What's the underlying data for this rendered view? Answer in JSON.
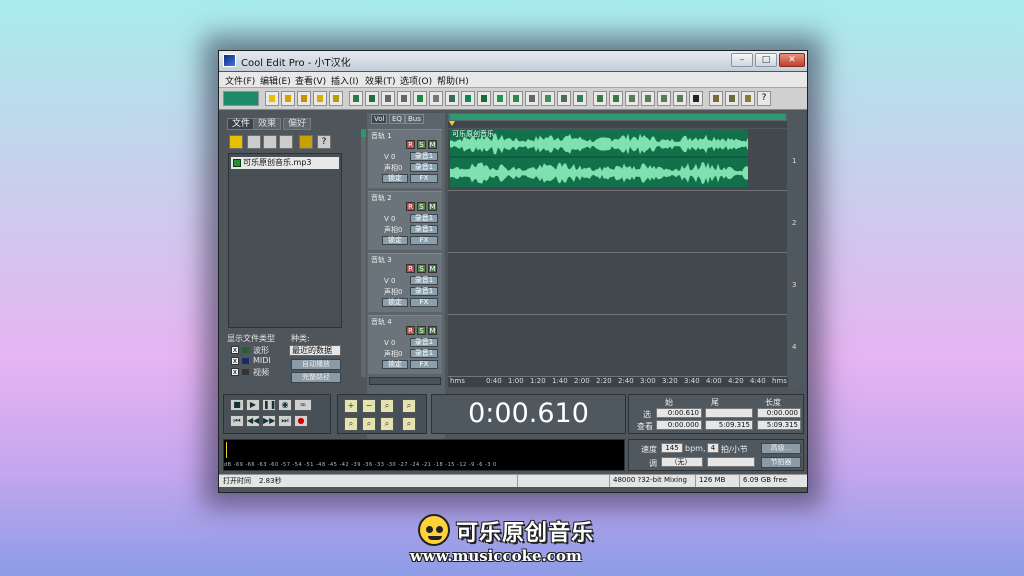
{
  "window": {
    "title": "Cool Edit Pro  - 小T汉化",
    "min": "–",
    "max": "□",
    "close": "✕"
  },
  "menu": [
    "文件(F)",
    "编辑(E)",
    "查看(V)",
    "插入(I)",
    "效果(T)",
    "选项(O)",
    "帮助(H)"
  ],
  "left": {
    "tabs": [
      "文件",
      "效果",
      "偏好"
    ],
    "file": "可乐原创音乐.mp3",
    "show_types": "显示文件类型",
    "kind": "种类:",
    "types": [
      "波形",
      "MIDI",
      "视频"
    ],
    "sort": "最近的数据",
    "btn1": "自动播放",
    "btn2": "完整路径"
  },
  "tracks": [
    {
      "name": "音轨 1",
      "v": "V 0",
      "pan": "声相0",
      "b1": "录音1",
      "b2": "录音1",
      "b3": "锁定",
      "fx": "FX",
      "clip": "可乐原创音乐"
    },
    {
      "name": "音轨 2",
      "v": "V 0",
      "pan": "声相0",
      "b1": "录音1",
      "b2": "录音1",
      "b3": "锁定",
      "fx": "FX"
    },
    {
      "name": "音轨 3",
      "v": "V 0",
      "pan": "声相0",
      "b1": "录音1",
      "b2": "录音1",
      "b3": "锁定",
      "fx": "FX"
    },
    {
      "name": "音轨 4",
      "v": "V 0",
      "pan": "声相0",
      "b1": "录音1",
      "b2": "录音1",
      "b3": "锁定",
      "fx": "FX"
    }
  ],
  "track_tabs": [
    "Vol",
    "EQ",
    "Bus"
  ],
  "ruler": [
    "hms",
    "0:40",
    "1:00",
    "1:20",
    "1:40",
    "2:00",
    "2:20",
    "2:40",
    "3:00",
    "3:20",
    "3:40",
    "4:00",
    "4:20",
    "4:40",
    "hms"
  ],
  "lane_numbers": [
    "1",
    "2",
    "3",
    "4"
  ],
  "time": "0:00.610",
  "info": {
    "h_start": "始",
    "h_end": "尾",
    "h_len": "长度",
    "row1": "选",
    "row2": "查看",
    "sel_start": "0:00.610",
    "sel_end": "",
    "sel_len": "0:00.000",
    "view_start": "0:00.000",
    "view_end": "5:09.315",
    "view_len": "5:09.315"
  },
  "bpm": {
    "tempo_label": "速度",
    "tempo": "145",
    "bpm": "bpm,",
    "beats": "4",
    "beats_label": "拍/小节",
    "key_label": "调",
    "key": "（无）",
    "btn1": "高级...",
    "btn2": "节拍器"
  },
  "meter_scale": "dB -69 -66 -63 -60 -57 -54 -51 -48 -45 -42 -39 -36 -33 -30 -27 -24 -21 -18 -15 -12 -9 -6 -3 0",
  "status": {
    "open": "打开时间",
    "secs": "2.83秒",
    "fmt": "48000 ?32-bit Mixing",
    "mem": "126 MB",
    "disk": "6.09 GB free"
  },
  "brand": {
    "name": "可乐原创音乐",
    "url": "www.musiccoke.com"
  }
}
